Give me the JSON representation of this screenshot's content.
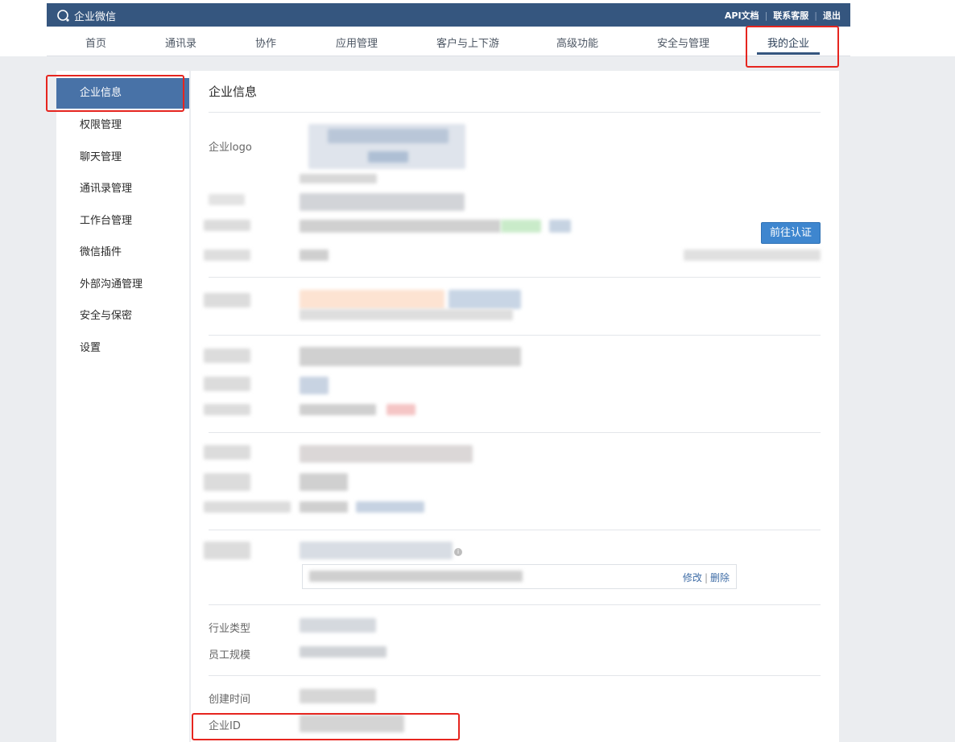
{
  "header": {
    "brand": "企业微信",
    "links": [
      "API文档",
      "联系客服",
      "退出"
    ]
  },
  "nav": {
    "items": [
      "首页",
      "通讯录",
      "协作",
      "应用管理",
      "客户与上下游",
      "高级功能",
      "安全与管理",
      "我的企业"
    ],
    "active": "我的企业"
  },
  "sidebar": {
    "items": [
      "企业信息",
      "权限管理",
      "聊天管理",
      "通讯录管理",
      "工作台管理",
      "微信插件",
      "外部沟通管理",
      "安全与保密",
      "设置"
    ],
    "active": "企业信息"
  },
  "content": {
    "title": "企业信息",
    "logo_label": "企业logo",
    "verify_button": "前往认证",
    "edit_link": "修改",
    "delete_link": "删除",
    "industry_label": "行业类型",
    "staff_size_label": "员工规模",
    "created_label": "创建时间",
    "corp_id_label": "企业ID"
  },
  "colors": {
    "header_bg": "#35567f",
    "active_bg": "#4872a7",
    "button_bg": "#3e86cf",
    "highlight": "#e6251f"
  }
}
